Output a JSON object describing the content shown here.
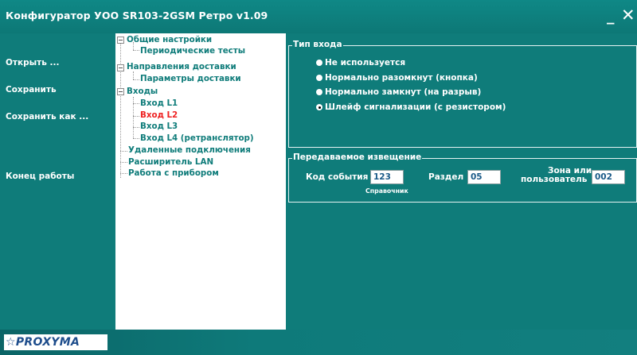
{
  "window": {
    "title": "Конфигуратор УОО SR103-2GSM Ретро v1.09",
    "min_glyph": "_",
    "close_glyph": "✕"
  },
  "sidebar": {
    "open_label": "Открыть ...",
    "save_label": "Сохранить",
    "save_as_label": "Сохранить как ...",
    "exit_label": "Конец  работы"
  },
  "tree": {
    "general": "Общие настройки",
    "periodic_tests": "Периодические тесты",
    "delivery_directions": "Направления доставки",
    "delivery_params": "Параметры доставки",
    "inputs": "Входы",
    "input_l1": "Вход L1",
    "input_l2": "Вход L2",
    "input_l3": "Вход L3",
    "input_l4": "Вход L4 (ретранслятор)",
    "remote": "Удаленные подключения",
    "lan": "Расширитель LAN",
    "device": "Работа с прибором"
  },
  "input_type": {
    "legend": "Тип входа",
    "options": [
      "Не используется",
      "Нормально разомкнут (кнопка)",
      "Нормально замкнут (на разрыв)",
      "Шлейф сигнализации (с резистором)"
    ],
    "selected_index": 3
  },
  "notification": {
    "legend": "Передаваемое извещение",
    "event_code_label": "Код события",
    "event_code_value": "123",
    "reference_link": "Справочник",
    "partition_label": "Раздел",
    "partition_value": "05",
    "zone_label_line1": "Зона или",
    "zone_label_line2": "пользователь",
    "zone_value": "002"
  },
  "footer": {
    "logo_text": "☆PROXYMA"
  },
  "colors": {
    "background": "#0f7c7a",
    "tree_text": "#0f7c7a",
    "selected_node": "#ee2222",
    "logo": "#1e4d8c"
  }
}
